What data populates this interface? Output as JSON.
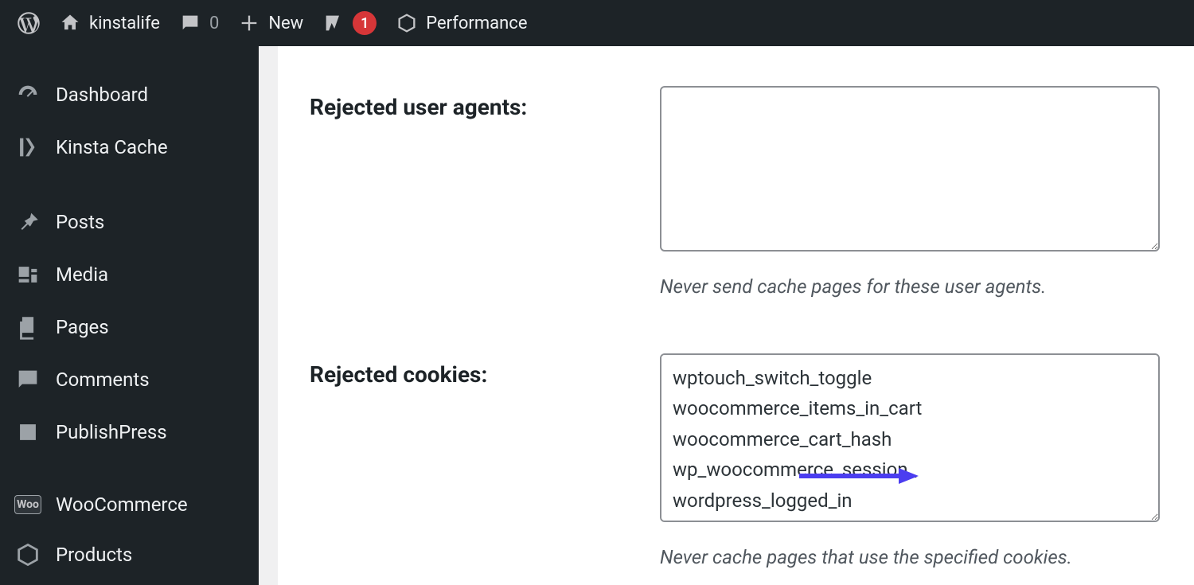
{
  "adminbar": {
    "site_title": "kinstalife",
    "comments_count": "0",
    "new_label": "New",
    "yoast_badge": "1",
    "performance_label": "Performance"
  },
  "sidebar": {
    "items": [
      {
        "label": "Dashboard"
      },
      {
        "label": "Kinsta Cache"
      },
      {
        "label": "Posts"
      },
      {
        "label": "Media"
      },
      {
        "label": "Pages"
      },
      {
        "label": "Comments"
      },
      {
        "label": "PublishPress"
      },
      {
        "label": "WooCommerce",
        "woo_tag": "Woo"
      },
      {
        "label": "Products"
      }
    ]
  },
  "form": {
    "user_agents": {
      "label": "Rejected user agents:",
      "value": "",
      "help": "Never send cache pages for these user agents."
    },
    "cookies": {
      "label": "Rejected cookies:",
      "value": "wptouch_switch_toggle\nwoocommerce_items_in_cart\nwoocommerce_cart_hash\nwp_woocommerce_session_\nwordpress_logged_in",
      "help": "Never cache pages that use the specified cookies."
    }
  },
  "colors": {
    "arrow": "#4b3df0"
  }
}
